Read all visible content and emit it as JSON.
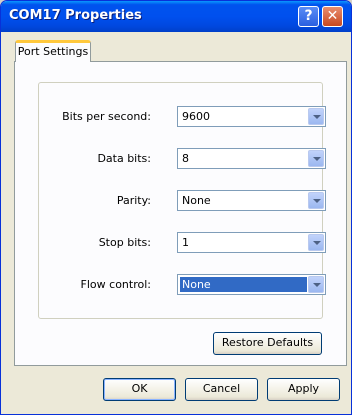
{
  "window": {
    "title": "COM17 Properties"
  },
  "titlebar": {
    "help_label": "?",
    "close_label": "✕"
  },
  "tabs": [
    {
      "label": "Port Settings"
    }
  ],
  "fields": [
    {
      "label": "Bits per second:",
      "value": "9600"
    },
    {
      "label": "Data bits:",
      "value": "8"
    },
    {
      "label": "Parity:",
      "value": "None"
    },
    {
      "label": "Stop bits:",
      "value": "1"
    },
    {
      "label": "Flow control:",
      "value": "None"
    }
  ],
  "buttons": {
    "restore_defaults": "Restore Defaults",
    "ok": "OK",
    "cancel": "Cancel",
    "apply": "Apply"
  }
}
